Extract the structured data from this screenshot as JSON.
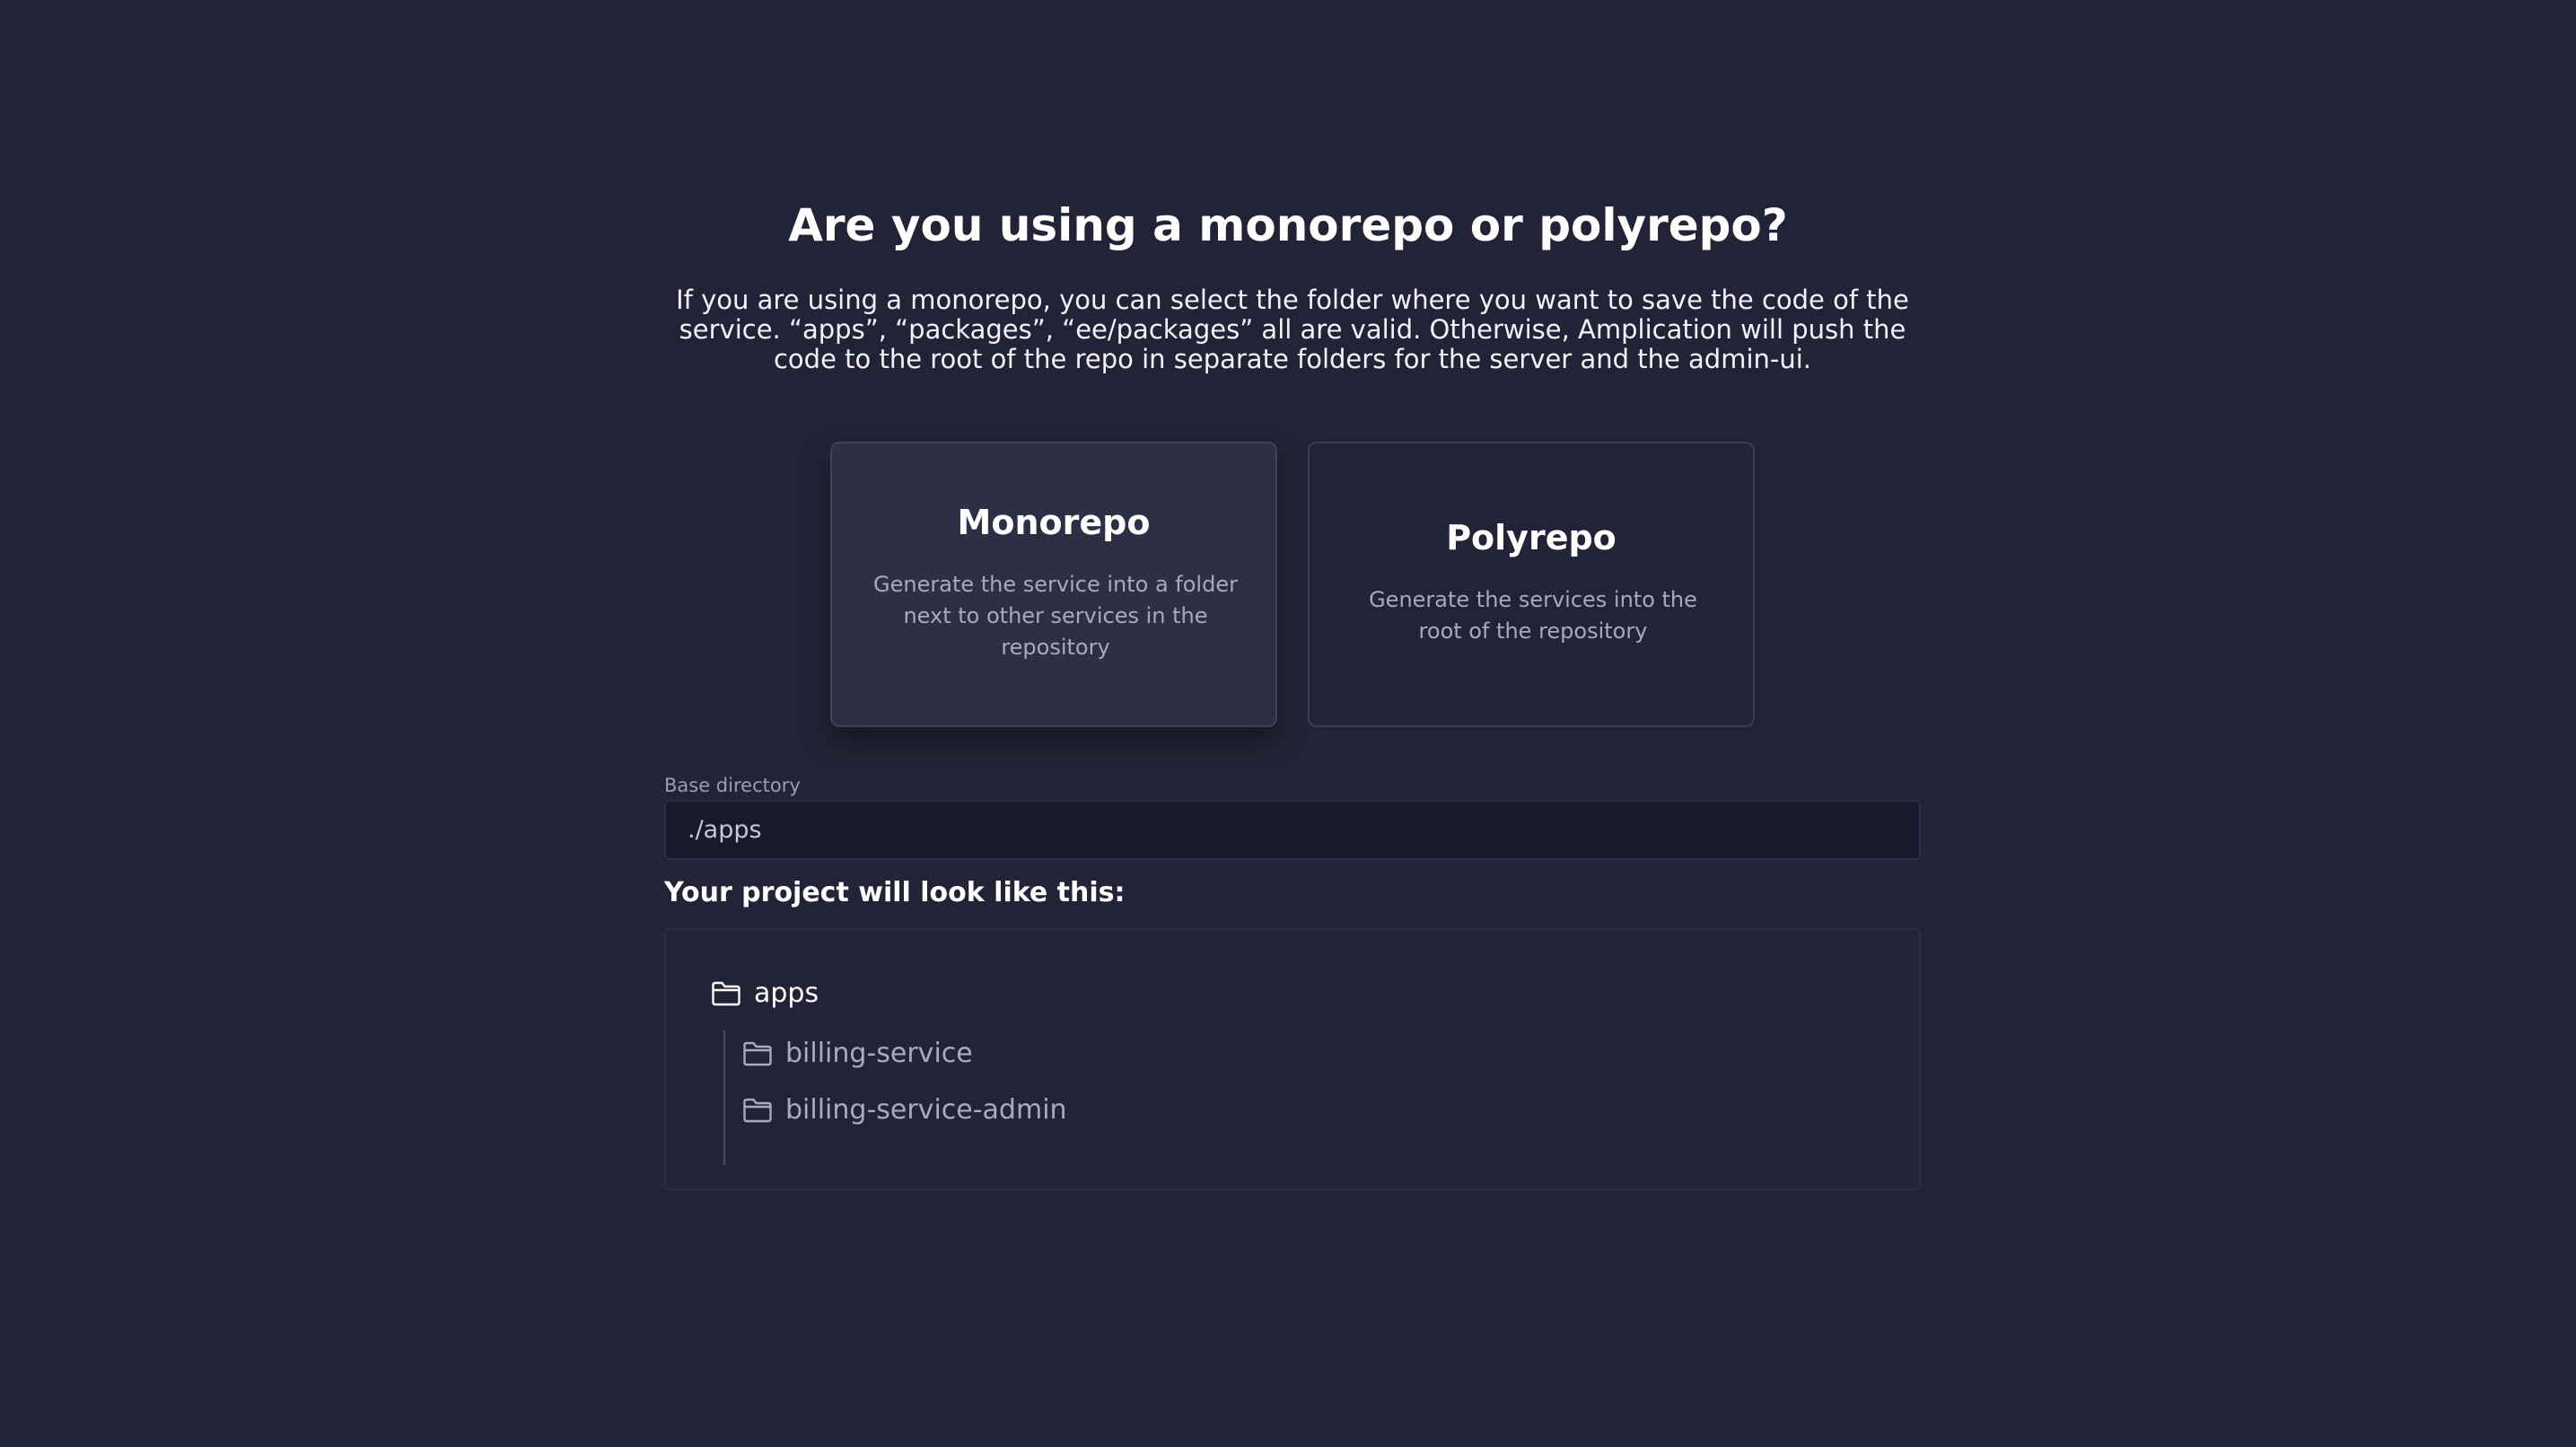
{
  "header": {
    "title": "Are you using a monorepo or polyrepo?",
    "description": "If you are using a monorepo, you can select the folder where you want to save the code of the service. “apps”, “packages”, “ee/packages” all are valid. Otherwise, Amplication will push the code to the root of the repo in separate folders for the server and the admin-ui."
  },
  "options": [
    {
      "title": "Monorepo",
      "description": "Generate the service into a folder next to other services in the repository",
      "selected": true
    },
    {
      "title": "Polyrepo",
      "description": "Generate the services into the root of the repository",
      "selected": false
    }
  ],
  "base_directory": {
    "label": "Base directory",
    "value": "./apps"
  },
  "preview": {
    "heading": "Your project will look like this:",
    "root_folder": {
      "name": "apps",
      "icon": "folder-icon"
    },
    "children": [
      {
        "name": "billing-service",
        "icon": "folder-icon"
      },
      {
        "name": "billing-service-admin",
        "icon": "folder-icon"
      }
    ]
  },
  "colors": {
    "background": "#222336",
    "card_selected": "#2d3044",
    "input_background": "#171a2b",
    "border": "#3a3d52",
    "muted_text": "#a7aabb"
  }
}
